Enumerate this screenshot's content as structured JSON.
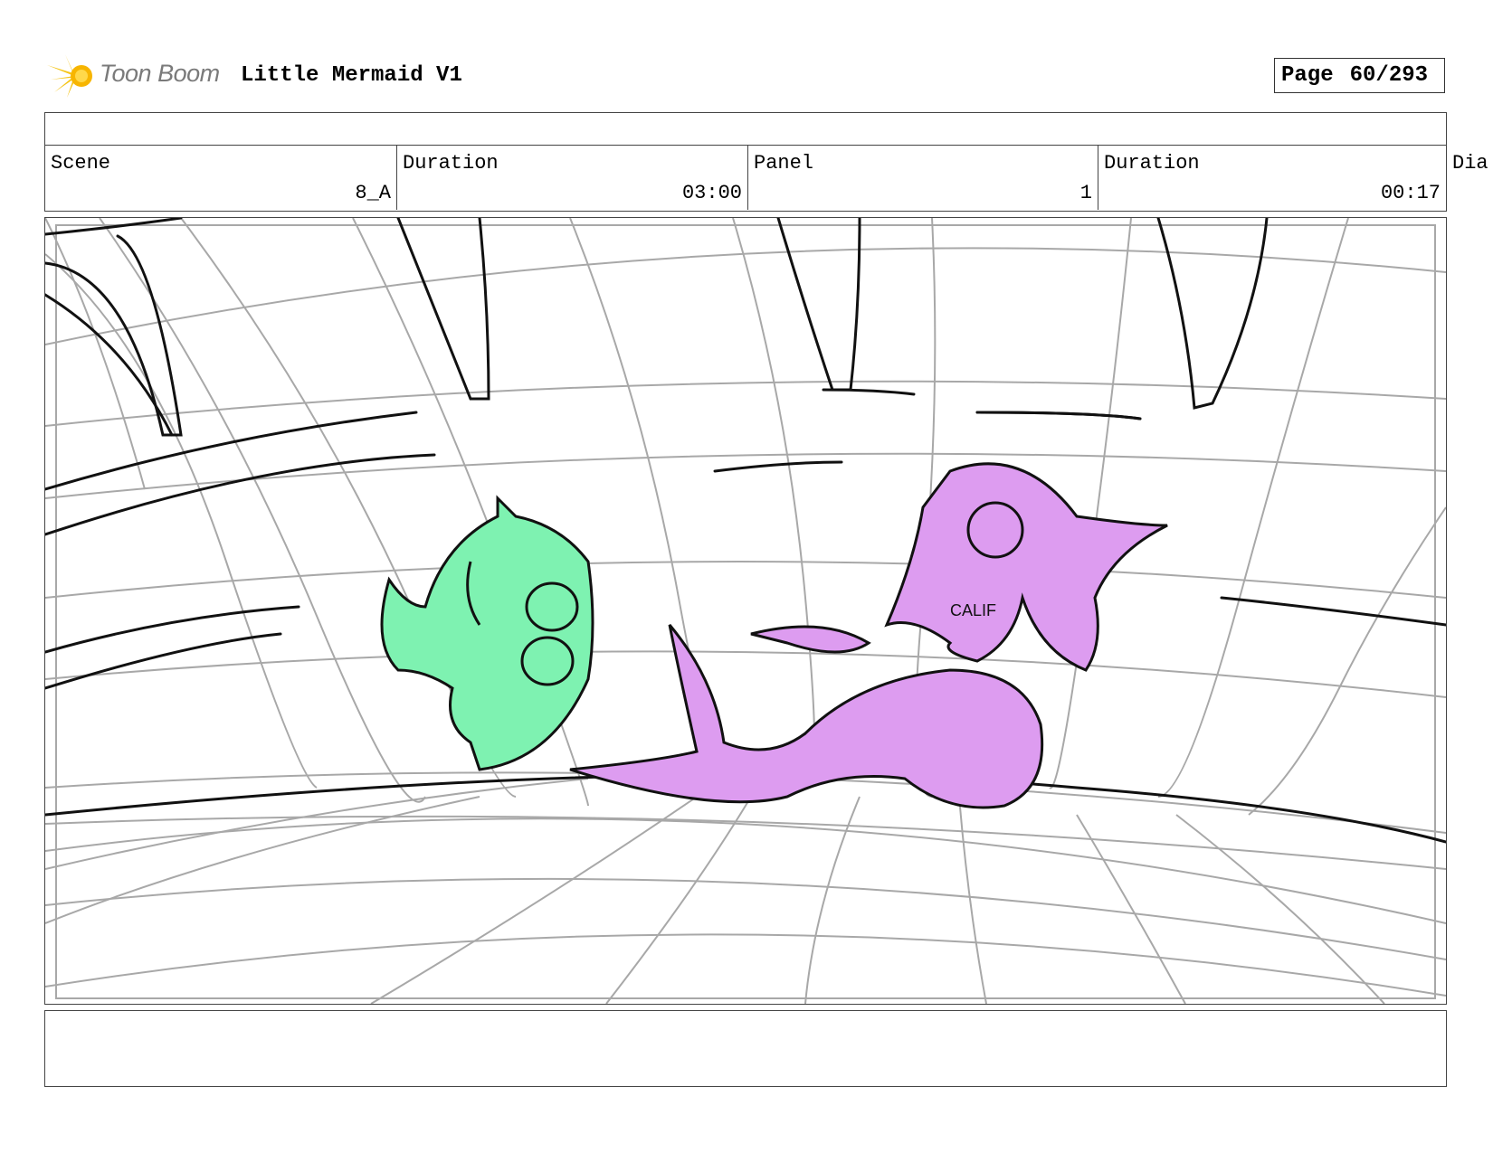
{
  "header": {
    "brand": "Toon Boom",
    "project_title": "Little Mermaid V1",
    "page_label": "Page",
    "page_number": "60/293"
  },
  "info": {
    "scene_label": "Scene",
    "scene_value": "8_A",
    "scene_duration_label": "Duration",
    "scene_duration_value": "03:00",
    "panel_label": "Panel",
    "panel_value": "1",
    "panel_duration_label": "Duration",
    "panel_duration_value": "00:17",
    "dialogue_label": "Dia"
  },
  "drawing": {
    "shirt_text": "CALIF",
    "fish_color": "#7ef2b1",
    "mermaid_color": "#dd9cf0",
    "grid_color": "#a8a8a8",
    "logo_color": "#f5c518"
  }
}
